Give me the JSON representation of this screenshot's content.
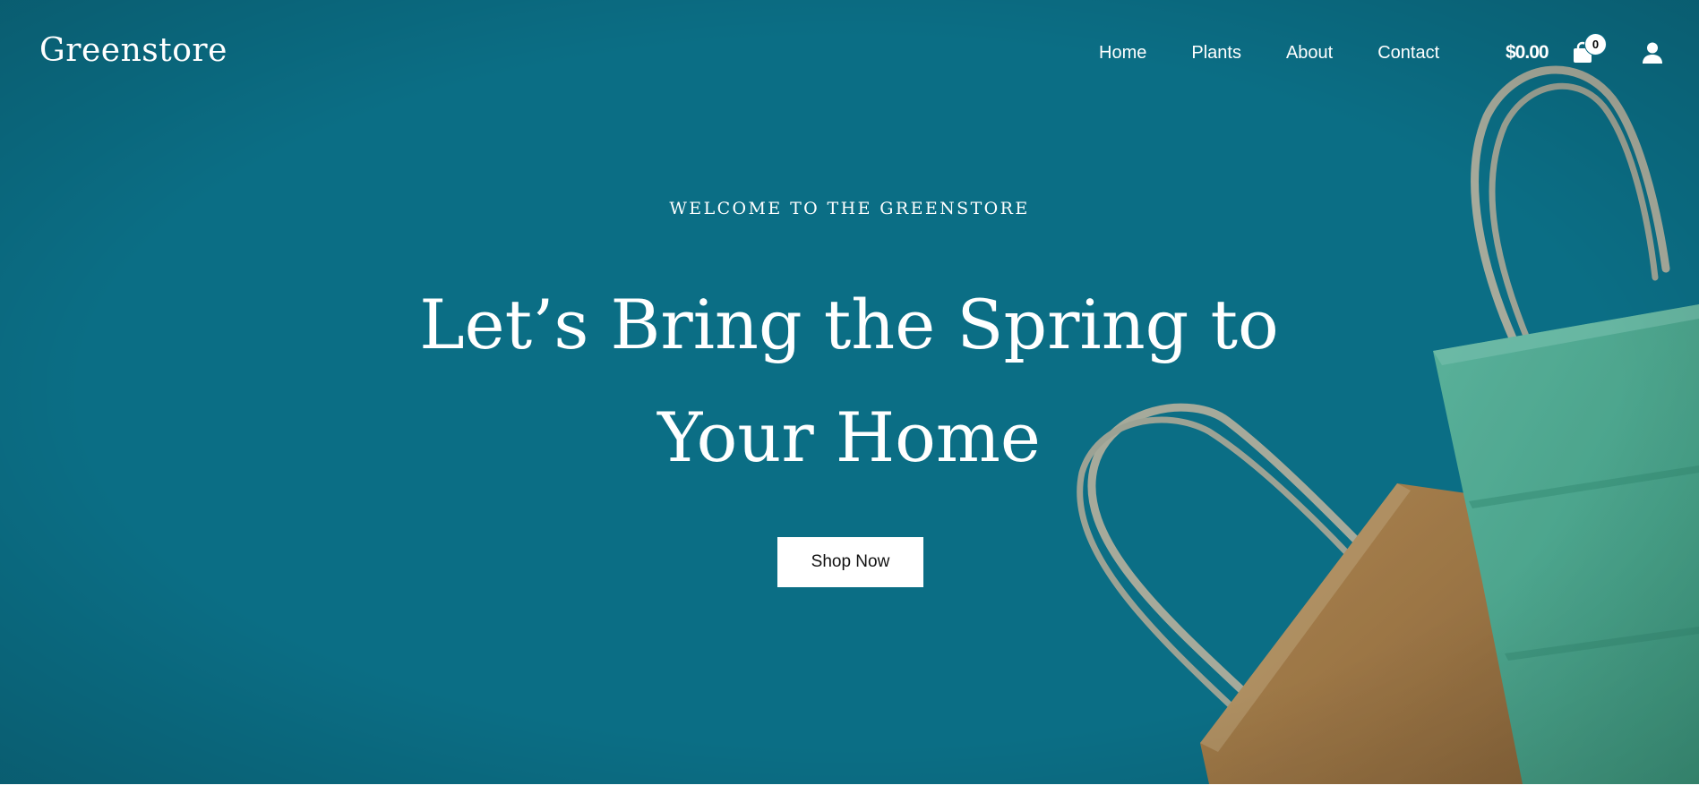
{
  "brand": {
    "logo_text": "Greenstore"
  },
  "nav": {
    "items": [
      {
        "label": "Home"
      },
      {
        "label": "Plants"
      },
      {
        "label": "About"
      },
      {
        "label": "Contact"
      }
    ]
  },
  "cart": {
    "total": "$0.00",
    "count": "0",
    "icon": "shopping-bag-icon"
  },
  "account": {
    "icon": "user-icon"
  },
  "hero": {
    "eyebrow": "WELCOME TO THE GREENSTORE",
    "headline_line1": "Let’s Bring the Spring to",
    "headline_line2": "Your Home",
    "cta_label": "Shop Now",
    "background_color": "#0c6e86",
    "image": "shopping-bags-photo"
  },
  "colors": {
    "accent": "#0c6e86",
    "text": "#ffffff",
    "button_bg": "#ffffff",
    "bag_orange": "#c27a35",
    "bag_green": "#5dae8a"
  }
}
